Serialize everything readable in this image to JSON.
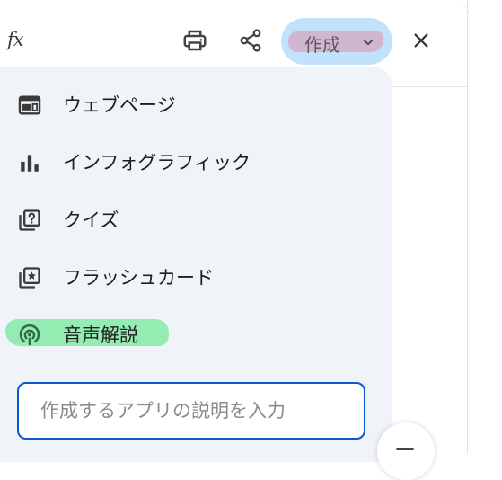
{
  "toolbar": {
    "fx_label": "fx",
    "create_label": "作成",
    "icons": {
      "print": "print-icon",
      "share": "share-icon",
      "close": "close-icon",
      "dropdown": "chevron-down-icon"
    }
  },
  "menu": {
    "items": [
      {
        "label": "ウェブページ",
        "icon": "webpage-icon"
      },
      {
        "label": "インフォグラフィック",
        "icon": "bar-chart-icon"
      },
      {
        "label": "クイズ",
        "icon": "quiz-icon"
      },
      {
        "label": "フラッシュカード",
        "icon": "flashcard-icon"
      },
      {
        "label": "音声解説",
        "icon": "podcast-icon"
      }
    ]
  },
  "description_input": {
    "placeholder": "作成するアプリの説明を入力",
    "value": ""
  },
  "colors": {
    "accent": "#0b57d0",
    "create_button_bg": "#c2e2fb",
    "menu_bg": "#f0f4f9",
    "highlight_green": "#84eaa6",
    "highlight_pink": "#d6a7c0"
  }
}
